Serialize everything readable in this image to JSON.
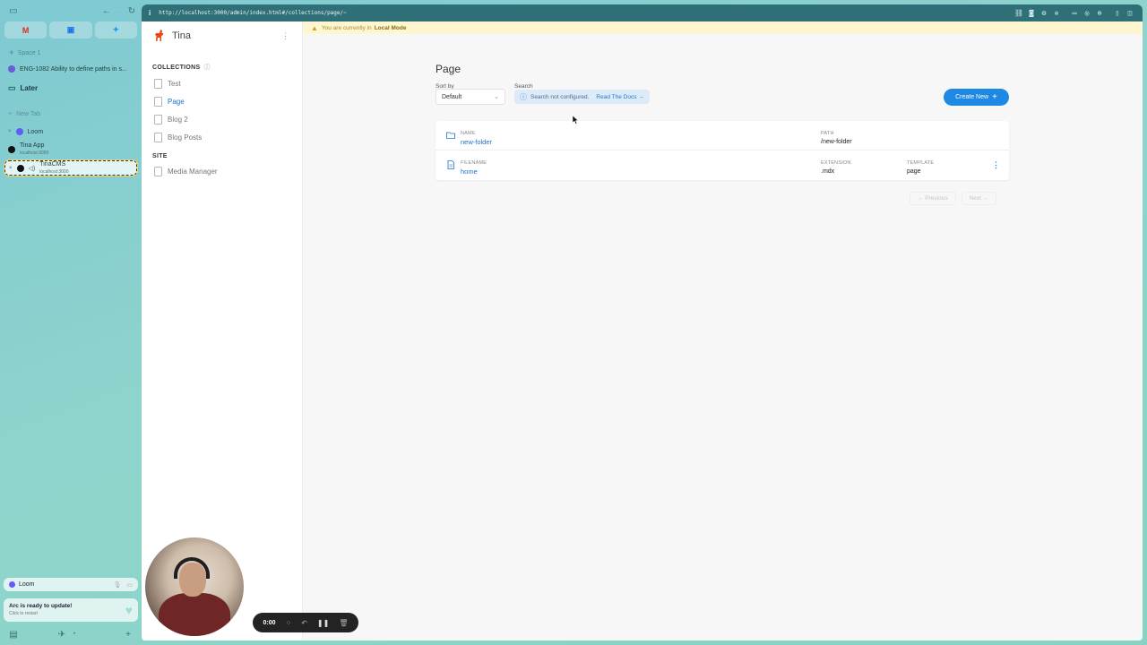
{
  "colors": {
    "accent": "#1e88e5",
    "link": "#1f6fd1",
    "arc_url_bar": "#2f7078",
    "banner_bg": "#fdf6d0",
    "tina_logo": "#ec4815"
  },
  "arc": {
    "favorites": [
      {
        "icon": "gmail-icon",
        "glyph": "M",
        "color": "#d93025"
      },
      {
        "icon": "google-calendar-icon",
        "glyph": "▣",
        "color": "#1a73e8"
      },
      {
        "icon": "twitter-icon",
        "glyph": "✦",
        "color": "#1d9bf0"
      }
    ],
    "space_label": "Space 1",
    "pinned_item": "ENG-1082 Ability to define paths in s...",
    "later": "Later",
    "new_tab": "New Tab",
    "loom_tab": "Loom",
    "tina_app": {
      "title": "Tina App",
      "sub": "localhost:3000"
    },
    "tinacms": {
      "title": "TinaCMS",
      "sub": "localhost:3000"
    },
    "loom_card": "Loom",
    "update_card": {
      "title": "Arc is ready to update!",
      "sub": "Click to restart"
    }
  },
  "browser": {
    "url": "http://localhost:3000/admin/index.html#/collections/page/~"
  },
  "tina": {
    "brand": "Tina",
    "collections_label": "COLLECTIONS",
    "collections": [
      "Test",
      "Page",
      "Blog 2",
      "Blog Posts"
    ],
    "active_collection": "Page",
    "site_label": "SITE",
    "site_items": [
      "Media Manager"
    ]
  },
  "banner": {
    "text": "You are currently in",
    "mode": "Local Mode"
  },
  "main": {
    "title": "Page",
    "sort_label": "Sort by",
    "sort_value": "Default",
    "search_label": "Search",
    "search_message": "Search not configured.",
    "search_link": "Read The Docs →",
    "create_button": "Create New",
    "rows": [
      {
        "type": "folder",
        "name_header": "NAME",
        "name": "new-folder",
        "path_header": "PATH",
        "path": "/new-folder"
      },
      {
        "type": "file",
        "name_header": "FILENAME",
        "name": "home",
        "ext_header": "EXTENSION",
        "ext": ".mdx",
        "tmpl_header": "TEMPLATE",
        "tmpl": "page"
      }
    ],
    "pager": {
      "prev": "← Previous",
      "next": "Next →"
    }
  },
  "loom": {
    "timer": "0:00"
  }
}
